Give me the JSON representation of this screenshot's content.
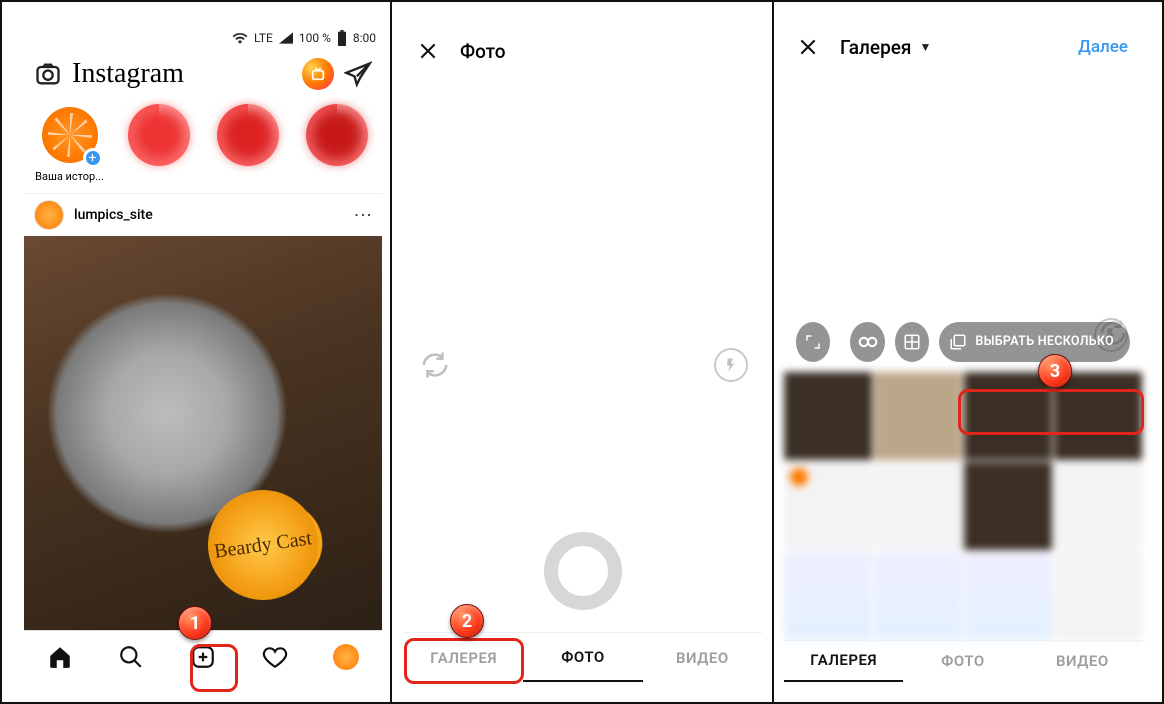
{
  "screen1": {
    "status": {
      "network": "LTE",
      "battery": "100 %",
      "time": "8:00"
    },
    "app_title": "Instagram",
    "stories": {
      "your_story_label": "Ваша истор..."
    },
    "post": {
      "username": "lumpics_site",
      "sticker_text": "Beardy Cast"
    },
    "nav": {
      "home": "home-icon",
      "search": "search-icon",
      "add": "add-post-icon",
      "activity": "heart-icon",
      "profile": "profile-avatar"
    }
  },
  "screen2": {
    "header_title": "Фото",
    "tabs": {
      "gallery": "ГАЛЕРЕЯ",
      "photo": "ФОТО",
      "video": "ВИДЕО"
    },
    "active_tab": "photo"
  },
  "screen3": {
    "header_title": "Галерея",
    "header_action": "Далее",
    "select_multiple_label": "ВЫБРАТЬ НЕСКОЛЬКО",
    "tabs": {
      "gallery": "ГАЛЕРЕЯ",
      "photo": "ФОТО",
      "video": "ВИДЕО"
    },
    "active_tab": "gallery"
  },
  "markers": {
    "m1": "1",
    "m2": "2",
    "m3": "3"
  }
}
